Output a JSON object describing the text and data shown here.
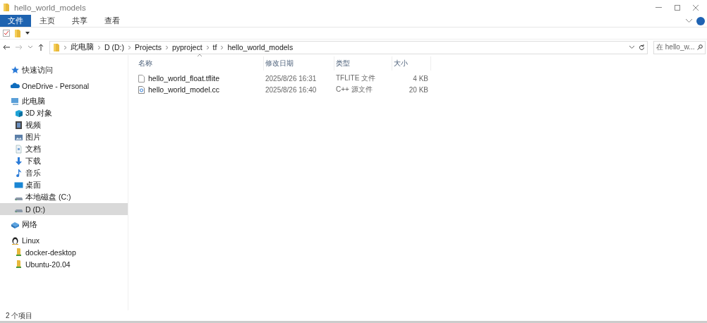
{
  "window": {
    "title": "hello_world_models"
  },
  "ribbon_tabs": [
    {
      "label": "文件",
      "selected": true
    },
    {
      "label": "主页",
      "selected": false
    },
    {
      "label": "共享",
      "selected": false
    },
    {
      "label": "查看",
      "selected": false
    }
  ],
  "address": {
    "segments": [
      "此电脑",
      "D (D:)",
      "Projects",
      "pyproject",
      "tf",
      "hello_world_models"
    ]
  },
  "search": {
    "placeholder": "在 hello_w..."
  },
  "sidebar": {
    "items": [
      {
        "label": "快速访问",
        "kind": "star",
        "selected": false
      },
      {
        "label": "OneDrive - Personal",
        "kind": "cloud",
        "selected": false
      },
      {
        "label": "此电脑",
        "kind": "pc",
        "selected": false,
        "children": [
          {
            "label": "3D 对象",
            "kind": "cube",
            "selected": false
          },
          {
            "label": "视频",
            "kind": "film",
            "selected": false
          },
          {
            "label": "图片",
            "kind": "image",
            "selected": false
          },
          {
            "label": "文档",
            "kind": "doc",
            "selected": false
          },
          {
            "label": "下载",
            "kind": "download",
            "selected": false
          },
          {
            "label": "音乐",
            "kind": "music",
            "selected": false
          },
          {
            "label": "桌面",
            "kind": "desktop",
            "selected": false
          },
          {
            "label": "本地磁盘 (C:)",
            "kind": "drive",
            "selected": false
          },
          {
            "label": "D (D:)",
            "kind": "drive",
            "selected": true
          }
        ]
      },
      {
        "label": "网络",
        "kind": "network",
        "selected": false
      },
      {
        "label": "Linux",
        "kind": "penguin",
        "selected": false,
        "children": [
          {
            "label": "docker-desktop",
            "kind": "folder",
            "selected": false
          },
          {
            "label": "Ubuntu-20.04",
            "kind": "folder",
            "selected": false
          }
        ]
      }
    ]
  },
  "table": {
    "columns": [
      "名称",
      "修改日期",
      "类型",
      "大小"
    ],
    "rows": [
      {
        "kind": "file",
        "cells": [
          "hello_world_float.tflite",
          "2025/8/26 16:31",
          "TFLITE 文件",
          "4 KB"
        ]
      },
      {
        "kind": "source",
        "cells": [
          "hello_world_model.cc",
          "2025/8/26 16:40",
          "C++ 源文件",
          "20 KB"
        ]
      }
    ]
  },
  "status_bar": {
    "text": "2 个项目"
  }
}
